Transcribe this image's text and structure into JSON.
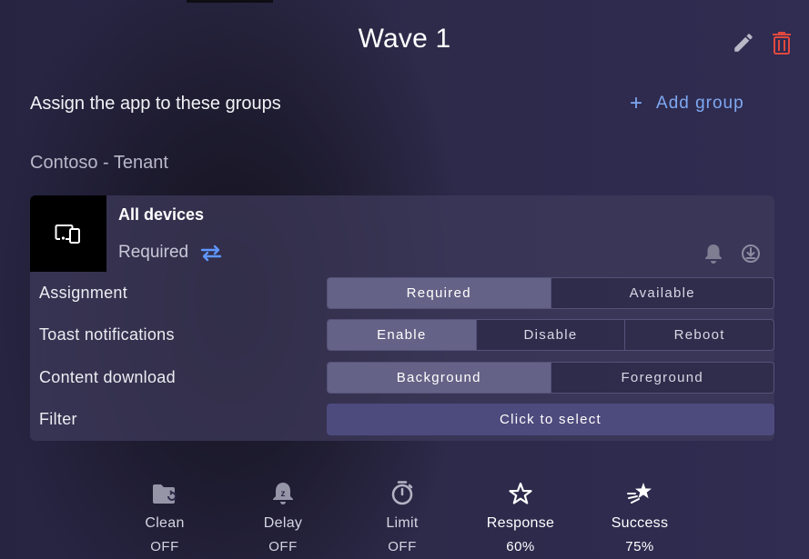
{
  "header": {
    "title": "Wave 1"
  },
  "assign": {
    "label": "Assign the app to these groups",
    "add_group": "Add group"
  },
  "tenant": {
    "label": "Contoso - Tenant"
  },
  "group": {
    "name": "All devices",
    "mode": "Required",
    "icons": [
      "devices-icon",
      "swap-icon",
      "bell-icon",
      "download-icon"
    ]
  },
  "settings": {
    "assignment": {
      "label": "Assignment",
      "options": [
        "Required",
        "Available"
      ],
      "selected": "Required"
    },
    "toast": {
      "label": "Toast notifications",
      "options": [
        "Enable",
        "Disable",
        "Reboot"
      ],
      "selected": "Enable"
    },
    "content": {
      "label": "Content download",
      "options": [
        "Background",
        "Foreground"
      ],
      "selected": "Background"
    },
    "filter": {
      "label": "Filter",
      "button": "Click to select"
    }
  },
  "stats": [
    {
      "label": "Clean",
      "value": "OFF",
      "icon": "folder-icon"
    },
    {
      "label": "Delay",
      "value": "OFF",
      "icon": "bell-icon"
    },
    {
      "label": "Limit",
      "value": "OFF",
      "icon": "timer-icon"
    },
    {
      "label": "Response",
      "value": "60%",
      "icon": "star-icon"
    },
    {
      "label": "Success",
      "value": "75%",
      "icon": "shooting-star-icon"
    }
  ],
  "colors": {
    "accent": "#7fa8f2",
    "delete": "#e2483f",
    "active_segment": "#646286",
    "filter_button": "#4d4a7d"
  }
}
